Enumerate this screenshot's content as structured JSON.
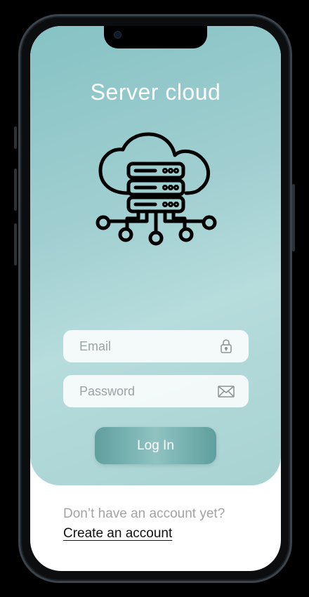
{
  "app": {
    "title": "Server cloud"
  },
  "hero": {
    "icon": "cloud-server-icon"
  },
  "form": {
    "email_placeholder": "Email",
    "email_icon": "lock-icon",
    "password_placeholder": "Password",
    "password_icon": "envelope-icon",
    "login_label": "Log In"
  },
  "footer": {
    "prompt": "Don’t have an account yet?",
    "create_link": "Create an account"
  },
  "colors": {
    "hero_top": "#86c2c4",
    "hero_bottom": "#a8d2d2",
    "button": "#6aa7a6",
    "text_muted": "#a3a3a3"
  }
}
